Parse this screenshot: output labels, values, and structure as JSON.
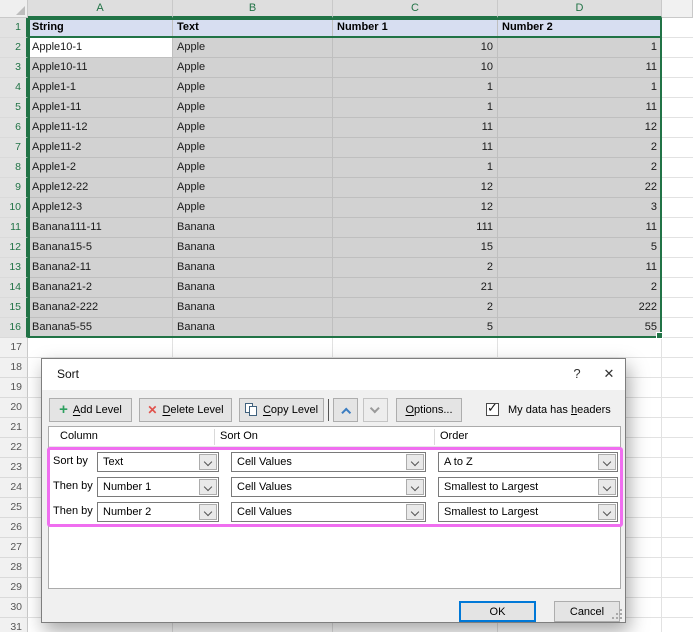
{
  "spreadsheet": {
    "column_headers": [
      "A",
      "B",
      "C",
      "D"
    ],
    "visible_row_numbers": 31,
    "active_cell": "A2",
    "table": {
      "headers": [
        "String",
        "Text",
        "Number 1",
        "Number 2"
      ],
      "rows": [
        [
          "Apple10-1",
          "Apple",
          "10",
          "1"
        ],
        [
          "Apple10-11",
          "Apple",
          "10",
          "11"
        ],
        [
          "Apple1-1",
          "Apple",
          "1",
          "1"
        ],
        [
          "Apple1-11",
          "Apple",
          "1",
          "11"
        ],
        [
          "Apple11-12",
          "Apple",
          "11",
          "12"
        ],
        [
          "Apple11-2",
          "Apple",
          "11",
          "2"
        ],
        [
          "Apple1-2",
          "Apple",
          "1",
          "2"
        ],
        [
          "Apple12-22",
          "Apple",
          "12",
          "22"
        ],
        [
          "Apple12-3",
          "Apple",
          "12",
          "3"
        ],
        [
          "Banana111-11",
          "Banana",
          "111",
          "11"
        ],
        [
          "Banana15-5",
          "Banana",
          "15",
          "5"
        ],
        [
          "Banana2-11",
          "Banana",
          "2",
          "11"
        ],
        [
          "Banana21-2",
          "Banana",
          "21",
          "2"
        ],
        [
          "Banana2-222",
          "Banana",
          "2",
          "222"
        ],
        [
          "Banana5-55",
          "Banana",
          "5",
          "55"
        ]
      ]
    }
  },
  "dialog": {
    "title": "Sort",
    "help_icon": "?",
    "close_icon": "✕",
    "toolbar": {
      "add_level": {
        "label": "Add Level",
        "mnemonic_index": 0
      },
      "delete_level": {
        "label": "Delete Level",
        "mnemonic_index": 0
      },
      "copy_level": {
        "label": "Copy Level",
        "mnemonic_index": 0
      },
      "options": {
        "label": "Options...",
        "mnemonic_index": 0
      },
      "headers_checkbox": {
        "label": "My data has headers",
        "mnemonic_index": 12,
        "checked": true
      }
    },
    "grid_headers": [
      "Column",
      "Sort On",
      "Order"
    ],
    "levels": [
      {
        "label": "Sort by",
        "column": "Text",
        "sort_on": "Cell Values",
        "order": "A to Z"
      },
      {
        "label": "Then by",
        "column": "Number 1",
        "sort_on": "Cell Values",
        "order": "Smallest to Largest"
      },
      {
        "label": "Then by",
        "column": "Number 2",
        "sort_on": "Cell Values",
        "order": "Smallest to Largest"
      }
    ],
    "ok_label": "OK",
    "cancel_label": "Cancel"
  },
  "colors": {
    "excel_green": "#217346",
    "selection_fill": "#D2D2D2",
    "table_header_fill": "#D7DEF1",
    "highlight_pink": "#F06EF0",
    "ok_button_border": "#0078D7"
  }
}
